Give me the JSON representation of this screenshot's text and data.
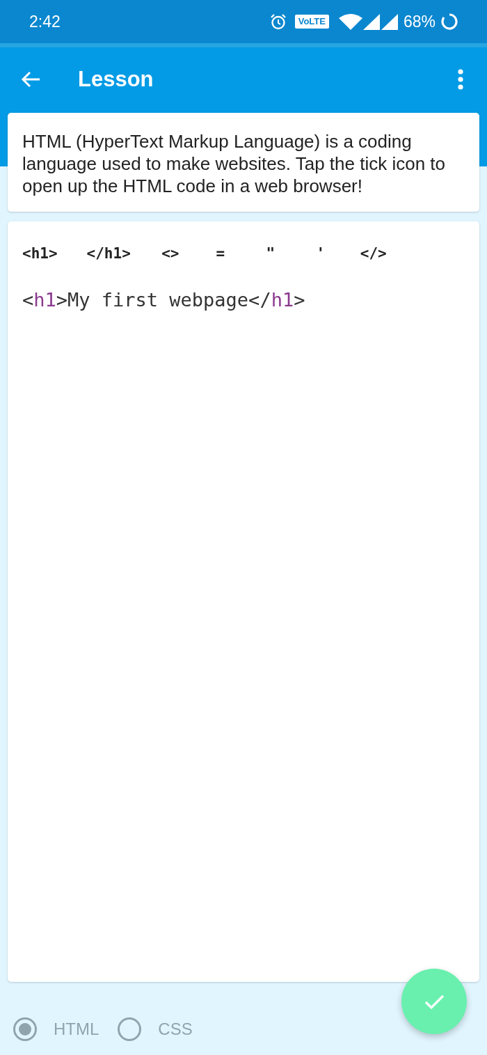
{
  "status_bar": {
    "time": "2:42",
    "network_badge": "VoLTE",
    "battery": "68%"
  },
  "app_bar": {
    "title": "Lesson"
  },
  "intro": {
    "text": "HTML (HyperText Markup Language) is a coding language used to make websites. Tap the tick icon to open up the HTML code in a web browser!"
  },
  "editor": {
    "symbol_keys": [
      "<h1>",
      "</h1>",
      "<>",
      "=",
      "\"",
      "'",
      "</>"
    ],
    "code_lines": [
      {
        "tokens": [
          {
            "kind": "text",
            "text": "<"
          },
          {
            "kind": "tag",
            "text": "h1"
          },
          {
            "kind": "text",
            "text": ">My first webpage</"
          },
          {
            "kind": "tag",
            "text": "h1"
          },
          {
            "kind": "text",
            "text": ">"
          }
        ]
      }
    ]
  },
  "languages": [
    {
      "label": "HTML",
      "selected": true
    },
    {
      "label": "CSS",
      "selected": false
    }
  ]
}
